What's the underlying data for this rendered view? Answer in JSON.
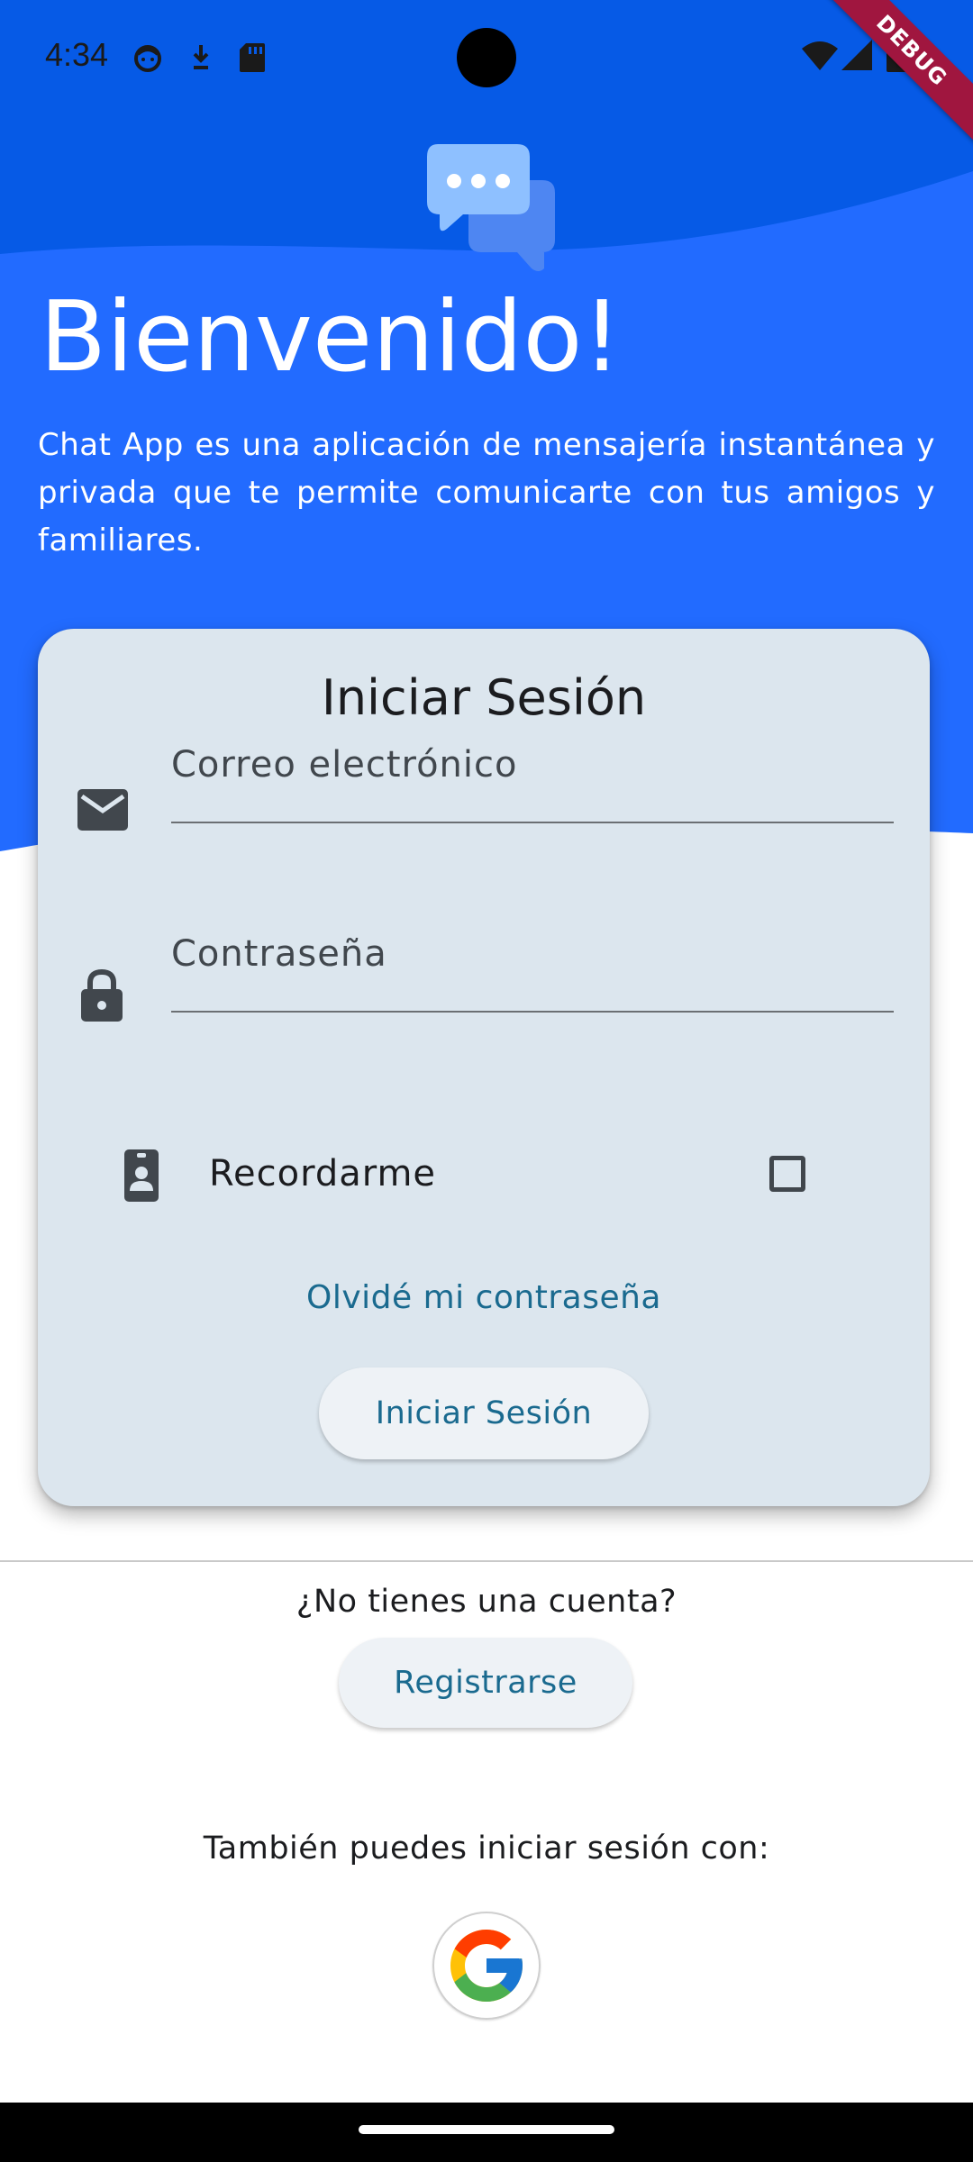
{
  "status_bar": {
    "time": "4:34",
    "left_icons": [
      "face-icon",
      "download-icon",
      "sd-card-icon"
    ],
    "right_icons": [
      "wifi-icon",
      "signal-icon",
      "battery-icon"
    ]
  },
  "debug_banner": "DEBUG",
  "colors": {
    "header_blue": "#226bff",
    "header_blue_dark": "#065ae6",
    "card_bg": "#dce6ee",
    "link": "#1a6a8f",
    "button_bg": "#eef2f6"
  },
  "header": {
    "logo_icon": "chat-bubbles-icon",
    "title": "Bienvenido!",
    "description": "Chat App es una aplicación de mensajería instantánea y privada que te permite comunicarte con tus amigos y familiares."
  },
  "login_card": {
    "title": "Iniciar Sesión",
    "email_label": "Correo electrónico",
    "password_label": "Contraseña",
    "remember_label": "Recordarme",
    "remember_checked": false,
    "forgot_link": "Olvidé mi contraseña",
    "submit_label": "Iniciar Sesión"
  },
  "register": {
    "prompt": "¿No tienes una cuenta?",
    "button_label": "Registrarse"
  },
  "social": {
    "prompt": "También puedes iniciar sesión con:",
    "providers": [
      "google-icon"
    ]
  }
}
